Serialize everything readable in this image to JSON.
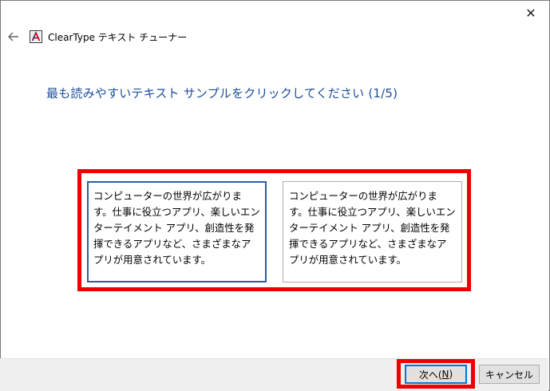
{
  "window": {
    "title": "ClearType テキスト チューナー",
    "close_glyph": "✕"
  },
  "main": {
    "heading": "最も読みやすいテキスト サンプルをクリックしてください (1/5)",
    "samples": [
      {
        "text": "コンピューターの世界が広がります。仕事に役立つアプリ、楽しいエンターテイメント アプリ、創造性を発揮できるアプリなど、さまざまなアプリが用意されています。",
        "selected": true
      },
      {
        "text": "コンピューターの世界が広がります。仕事に役立つアプリ、楽しいエンターテイメント アプリ、創造性を発揮できるアプリなど、さまざまなアプリが用意されています。",
        "selected": false
      }
    ]
  },
  "footer": {
    "next_label": "次へ(",
    "next_mnemonic": "N",
    "next_suffix": ")",
    "cancel_label": "キャンセル"
  },
  "colors": {
    "heading": "#1d4e9a",
    "highlight": "#ee0000",
    "selected_border": "#2a5fa6",
    "focus_border": "#0078d7"
  },
  "icons": {
    "back": "arrow-left-icon",
    "app": "cleartype-icon",
    "close": "close-icon"
  }
}
